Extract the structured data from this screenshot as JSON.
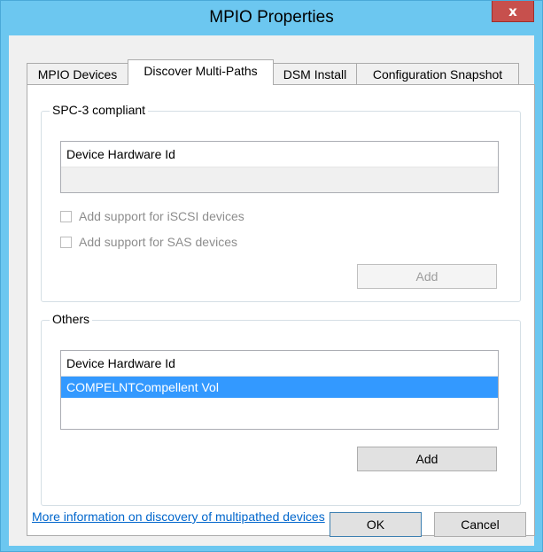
{
  "window": {
    "title": "MPIO Properties",
    "close_glyph": "x"
  },
  "tabs": [
    {
      "label": "MPIO Devices"
    },
    {
      "label": "Discover Multi-Paths"
    },
    {
      "label": "DSM Install"
    },
    {
      "label": "Configuration Snapshot"
    }
  ],
  "spc3": {
    "label": "SPC-3 compliant",
    "list_header": "Device Hardware Id",
    "checkbox_iscsi": "Add support for iSCSI devices",
    "checkbox_sas": "Add support for SAS devices",
    "add_label": "Add"
  },
  "others": {
    "label": "Others",
    "list_header": "Device Hardware Id",
    "items": [
      "COMPELNTCompellent Vol"
    ],
    "add_label": "Add"
  },
  "link": {
    "text": "More information on discovery of multipathed devices"
  },
  "footer": {
    "ok_label": "OK",
    "cancel_label": "Cancel"
  }
}
